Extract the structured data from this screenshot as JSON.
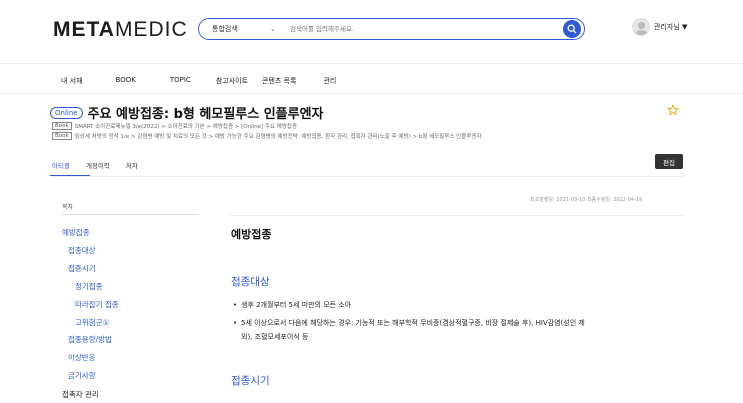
{
  "header": {
    "logo_bold": "META",
    "logo_light": "MEDIC",
    "search_scope": "통합검색",
    "search_placeholder": "검색어를 입력해주세요.",
    "user_name": "관리자님 ▼"
  },
  "gnb": [
    "내 서재",
    "BOOK",
    "TOPIC",
    "참고사이트",
    "콘텐츠 목록",
    "관리"
  ],
  "article": {
    "badge": "Online",
    "title": "주요 예방접종: b형 헤모필루스 인플루엔자",
    "sources": [
      {
        "tag": "Book",
        "text": "SMART 소아진료매뉴얼 3/e(2022) > 소아진료의 기본 > 예방접종 > [Online] 주요 예방접종"
      },
      {
        "tag": "Book",
        "text": "임상세 처방의 정석 1/e > 감염병 예방 및 치료의 모든 것 > 예방 가능한 주요 감염병의 예방전략: 예방접종, 환자 관리, 접촉자 관리(노출 후 예방) > b형 헤모필루스 인플루엔자"
      }
    ],
    "tabs": [
      "아티클",
      "개정이력",
      "저자"
    ],
    "edit_label": "편집",
    "meta": "최초발행일: 2021-09-10   최종수정일: 2022-04-19"
  },
  "toc": {
    "title": "목차",
    "items": [
      "예방접종",
      "접종대상",
      "접종시기",
      "정기접종",
      "따라잡기 접종",
      "고위험군①",
      "접종용량/방법",
      "이상반응",
      "금기사항",
      "접촉자 관리"
    ]
  },
  "content": {
    "h1": "예방접종",
    "section1": "접종대상",
    "bullet1": "생후 2개월부터 5세 미만의 모든 소아",
    "bullet2_line1": "5세 이상으로서 다음에 해당하는 경우: 기능적 또는 해부학적 무비증(겸상적혈구증, 비장 절제술 후), HIV감염(성인 제",
    "bullet2_line2": "외), 조혈모세포이식 등",
    "section2": "접종시기"
  }
}
